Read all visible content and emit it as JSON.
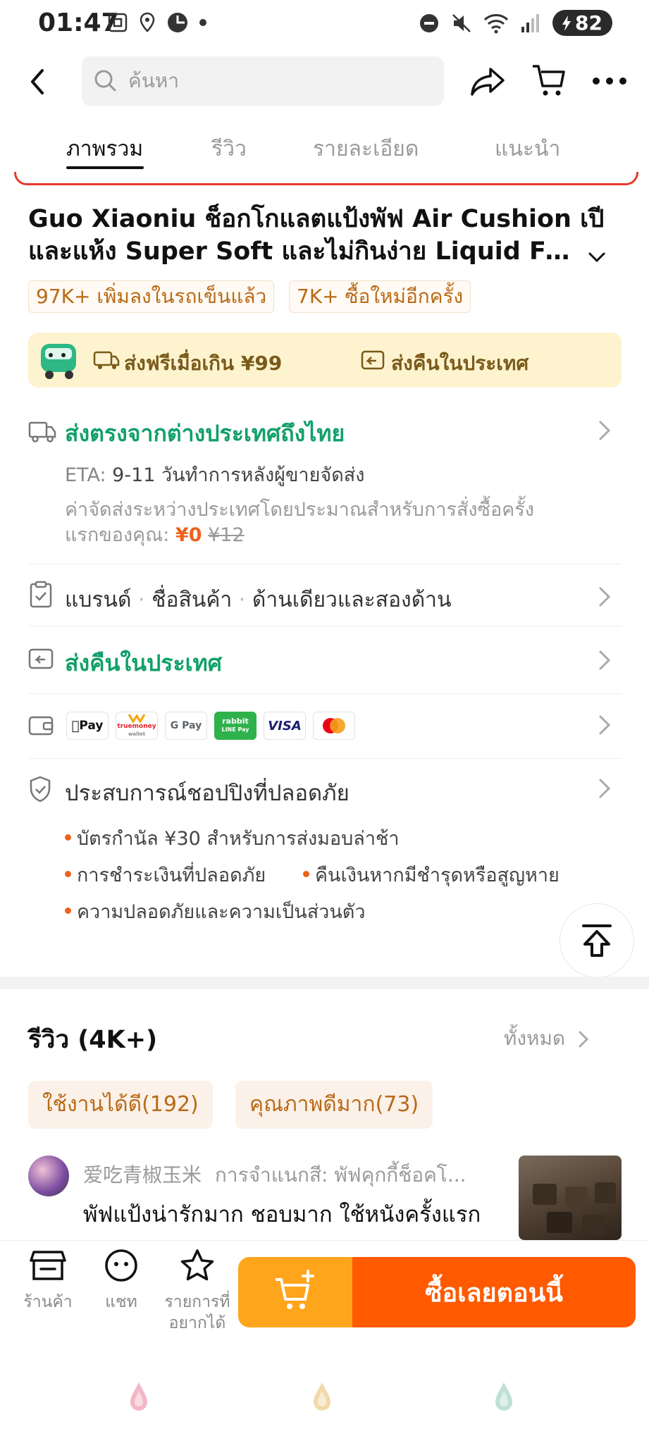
{
  "status_bar": {
    "time": "01:47",
    "battery": "82",
    "icons_left": [
      "screenshot-icon",
      "location-icon",
      "app-icon",
      "dot-icon"
    ],
    "icons_right": [
      "dnd-icon",
      "mute-icon",
      "wifi-icon",
      "signal-icon",
      "battery-icon"
    ]
  },
  "header": {
    "search_placeholder": "ค้นหา",
    "icons": [
      "back-icon",
      "share-icon",
      "cart-icon",
      "more-icon"
    ]
  },
  "tabs": [
    {
      "label": "ภาพรวม",
      "active": true
    },
    {
      "label": "รีวิว",
      "active": false
    },
    {
      "label": "รายละเอียด",
      "active": false
    },
    {
      "label": "แนะนำ",
      "active": false
    }
  ],
  "product": {
    "title_line1": "Guo Xiaoniu ช็อกโกแลตแป้งพัฟ Air Cushion เปียก",
    "title_line2": "และแห้ง Super Soft และไม่กินง่าย Liquid Foundation...",
    "badges": [
      "97K+ เพิ่มลงในรถเข็นแล้ว",
      "7K+ ซื้อใหม่อีกครั้ง"
    ]
  },
  "promo": {
    "free_shipping": "ส่งฟรีเมื่อเกิน ¥99",
    "domestic_return": "ส่งคืนในประเทศ"
  },
  "shipping": {
    "title": "ส่งตรงจากต่างประเทศถึงไทย",
    "eta_label": "ETA:",
    "eta_value": "9-11 วันทำการหลังผู้ขายจัดส่ง",
    "fee_line1": "ค่าจัดส่งระหว่างประเทศโดยประมาณสำหรับการสั่งซื้อครั้ง",
    "fee_line2_prefix": "แรกของคุณ:",
    "fee_now": "¥0",
    "fee_was": "¥12"
  },
  "specs": {
    "items": [
      "แบรนด์",
      "ชื่อสินค้า",
      "ด้านเดียวและสองด้าน"
    ],
    "separator": "·"
  },
  "returns": {
    "title": "ส่งคืนในประเทศ"
  },
  "payments": [
    "Apple Pay",
    "truemoney wallet",
    "G Pay",
    "rabbit LINE Pay",
    "VISA",
    "Mastercard"
  ],
  "payments_text": {
    "apple": "Pay",
    "truemoney": "truemoney",
    "truemoney_sub": "wallet",
    "gpay": "G Pay",
    "rabbit": "rabbit",
    "rabbit_sub": "LINE Pay",
    "visa": "VISA"
  },
  "safety": {
    "title": "ประสบการณ์ชอปปิงที่ปลอดภัย",
    "bullets": [
      "บัตรกำนัล ¥30 สำหรับการส่งมอบล่าช้า",
      "การชำระเงินที่ปลอดภัย",
      "คืนเงินหากมีชำรุดหรือสูญหาย",
      "ความปลอดภัยและความเป็นส่วนตัว"
    ]
  },
  "reviews": {
    "title": "รีวิว (4K+)",
    "all_label": "ทั้งหมด",
    "tags": [
      "ใช้งานได้ดี(192)",
      "คุณภาพดีมาก(73)"
    ],
    "first": {
      "user": "爱吃青椒玉米",
      "variant": "การจำแนกสี: พัฟคุกกี้ช็อคโ...",
      "text": "พัฟแป้งน่ารักมาก ชอบมาก ใช้หนังครั้งแรก"
    }
  },
  "bottom_bar": {
    "store": "ร้านค้า",
    "chat": "แชท",
    "wishlist_line1": "รายการที่",
    "wishlist_line2": "อยากได้",
    "buy_now": "ซื้อเลยตอนนี้"
  },
  "colors": {
    "accent_orange": "#ff5a00",
    "cart_yellow": "#ffa51b",
    "green": "#12a06b",
    "promo_bg": "#fdf3cf"
  }
}
